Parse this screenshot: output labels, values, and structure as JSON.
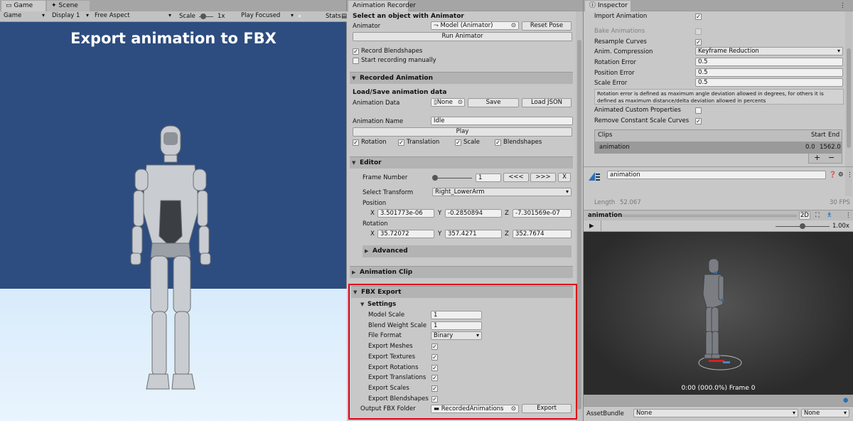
{
  "game": {
    "tabs": [
      "Game",
      "Scene"
    ],
    "toolbar": {
      "mode": "Game",
      "display": "Display 1",
      "aspect": "Free Aspect",
      "scale_label": "Scale",
      "scale_value": "1x",
      "play_mode": "Play Focused",
      "stats": "Stats"
    },
    "title": "Export animation to FBX"
  },
  "recorder": {
    "tab": "Animation Recorder",
    "select_header": "Select an object with Animator",
    "animator_label": "Animator",
    "animator_value": "Model (Animator)",
    "reset_pose": "Reset Pose",
    "run_animator": "Run Animator",
    "record_blendshapes": "Record Blendshapes",
    "start_manually": "Start recording manually",
    "recorded_animation": "Recorded Animation",
    "load_save_header": "Load/Save animation data",
    "animation_data_label": "Animation Data",
    "animation_data_value": "None",
    "save": "Save",
    "load_json": "Load JSON",
    "animation_name_label": "Animation Name",
    "animation_name_value": "Idle",
    "play": "Play",
    "toggles": [
      "Rotation",
      "Translation",
      "Scale",
      "Blendshapes"
    ],
    "editor": "Editor",
    "frame_number_label": "Frame Number",
    "frame_number_value": "1",
    "prev": "<<<",
    "next": ">>>",
    "close": "X",
    "select_transform_label": "Select Transform",
    "select_transform_value": "Right_LowerArm",
    "position_label": "Position",
    "position": {
      "x": "3.501773e-06",
      "y": "-0.2850894",
      "z": "-7.301569e-07"
    },
    "rotation_label": "Rotation",
    "rotation": {
      "x": "35.72072",
      "y": "357.4271",
      "z": "352.7674"
    },
    "axes": [
      "X",
      "Y",
      "Z"
    ],
    "advanced": "Advanced",
    "animation_clip": "Animation Clip",
    "fbx_export": "FBX Export",
    "settings": "Settings",
    "model_scale_label": "Model Scale",
    "model_scale_value": "1",
    "blend_weight_label": "Blend Weight Scale",
    "blend_weight_value": "1",
    "file_format_label": "File Format",
    "file_format_value": "Binary",
    "export_checks": [
      "Export Meshes",
      "Export Textures",
      "Export Rotations",
      "Export Translations",
      "Export Scales",
      "Export Blendshapes"
    ],
    "output_folder_label": "Output FBX Folder",
    "output_folder_value": "RecordedAnimations",
    "export": "Export",
    "highlight_color": "#e0001a"
  },
  "inspector": {
    "tab": "Inspector",
    "import_animation": "Import Animation",
    "bake_animations": "Bake Animations",
    "resample_curves": "Resample Curves",
    "anim_compression_label": "Anim. Compression",
    "anim_compression_value": "Keyframe Reduction",
    "rotation_error_label": "Rotation Error",
    "rotation_error_value": "0.5",
    "position_error_label": "Position Error",
    "position_error_value": "0.5",
    "scale_error_label": "Scale Error",
    "scale_error_value": "0.5",
    "help_text": "Rotation error is defined as maximum angle deviation allowed in degrees, for others it is defined as maximum distance/delta deviation allowed in percents",
    "animated_custom": "Animated Custom Properties",
    "remove_constant": "Remove Constant Scale Curves",
    "clips_header": "Clips",
    "start_header": "Start",
    "end_header": "End",
    "clip_name": "animation",
    "clip_start": "0.0",
    "clip_end": "1562.0",
    "plus": "+",
    "minus": "−",
    "clip_field": "animation",
    "length_label": "Length",
    "length_value": "52.067",
    "fps": "30 FPS",
    "preview_title": "animation",
    "preview_2d": "2D",
    "speed": "1.00x",
    "preview_status": "0:00 (000.0%) Frame 0",
    "assetbundle_label": "AssetBundle",
    "assetbundle_value": "None",
    "variant_value": "None"
  }
}
